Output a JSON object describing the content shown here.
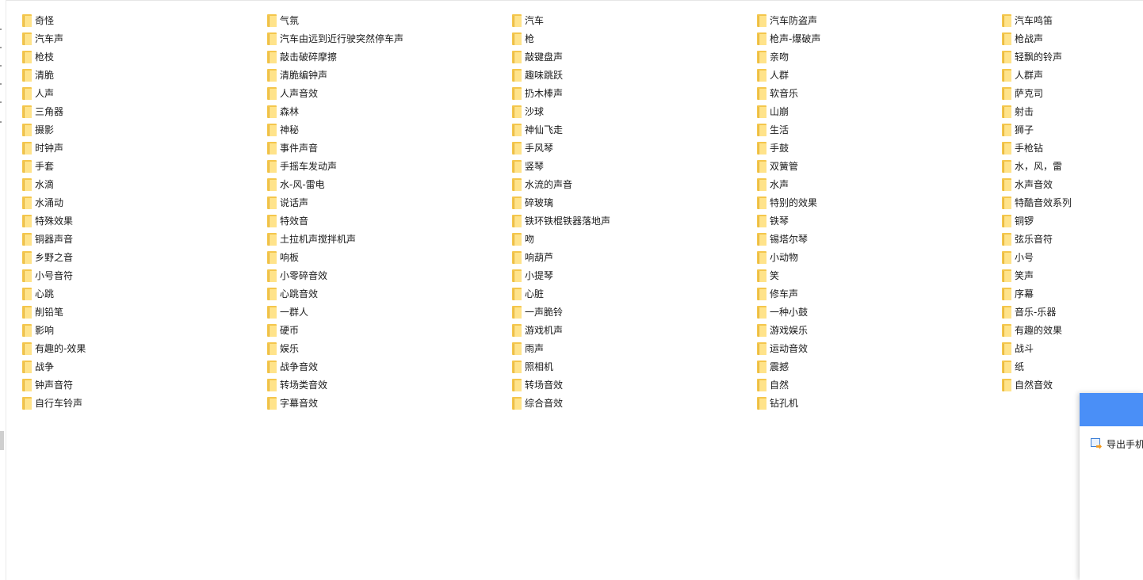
{
  "folders": [
    [
      "奇怪",
      "气氛",
      "汽车",
      "汽车防盗声",
      "汽车鸣笛"
    ],
    [
      "汽车声",
      "汽车由远到近行驶突然停车声",
      "枪",
      "枪声-爆破声",
      "枪战声"
    ],
    [
      "枪枝",
      "敲击破碎摩擦",
      "敲键盘声",
      "亲吻",
      "轻飘的铃声"
    ],
    [
      "清脆",
      "清脆编钟声",
      "趣味跳跃",
      "人群",
      "人群声"
    ],
    [
      "人声",
      "人声音效",
      "扔木棒声",
      "软音乐",
      "萨克司"
    ],
    [
      "三角器",
      "森林",
      "沙球",
      "山崩",
      "射击"
    ],
    [
      "摄影",
      "神秘",
      "神仙飞走",
      "生活",
      "狮子"
    ],
    [
      "时钟声",
      "事件声音",
      "手风琴",
      "手鼓",
      "手枪钻"
    ],
    [
      "手套",
      "手摇车发动声",
      "竖琴",
      "双簧管",
      "水，风，雷"
    ],
    [
      "水滴",
      "水-风-雷电",
      "水流的声音",
      "水声",
      "水声音效"
    ],
    [
      "水涌动",
      "说话声",
      "碎玻璃",
      "特别的效果",
      "特酷音效系列"
    ],
    [
      "特殊效果",
      "特效音",
      "铁环铁棍铁器落地声",
      "铁琴",
      "铜锣"
    ],
    [
      "铜器声音",
      "土拉机声搅拌机声",
      "吻",
      "锡塔尔琴",
      "弦乐音符"
    ],
    [
      "乡野之音",
      "响板",
      "响葫芦",
      "小动物",
      "小号"
    ],
    [
      "小号音符",
      "小零碎音效",
      "小提琴",
      "笑",
      "笑声"
    ],
    [
      "心跳",
      "心跳音效",
      "心脏",
      "修车声",
      "序幕"
    ],
    [
      "削铅笔",
      "一群人",
      "一声脆铃",
      "一种小鼓",
      "音乐-乐器"
    ],
    [
      "影响",
      "硬币",
      "游戏机声",
      "游戏娱乐",
      "有趣的效果"
    ],
    [
      "有趣的-效果",
      "娱乐",
      "雨声",
      "运动音效",
      "战斗"
    ],
    [
      "战争",
      "战争音效",
      "照相机",
      "震撼",
      "纸"
    ],
    [
      "钟声音符",
      "转场类音效",
      "转场音效",
      "自然",
      "自然音效"
    ],
    [
      "自行车铃声",
      "字幕音效",
      "综合音效",
      "钻孔机"
    ]
  ],
  "folder_icon": "folder-icon",
  "popup": {
    "export_label": "导出手机",
    "export_icon": "export-image-icon",
    "header_color": "#4a8ff7"
  },
  "colors": {
    "folder_back": "#f4c64c",
    "folder_front": "#ffe38a"
  }
}
